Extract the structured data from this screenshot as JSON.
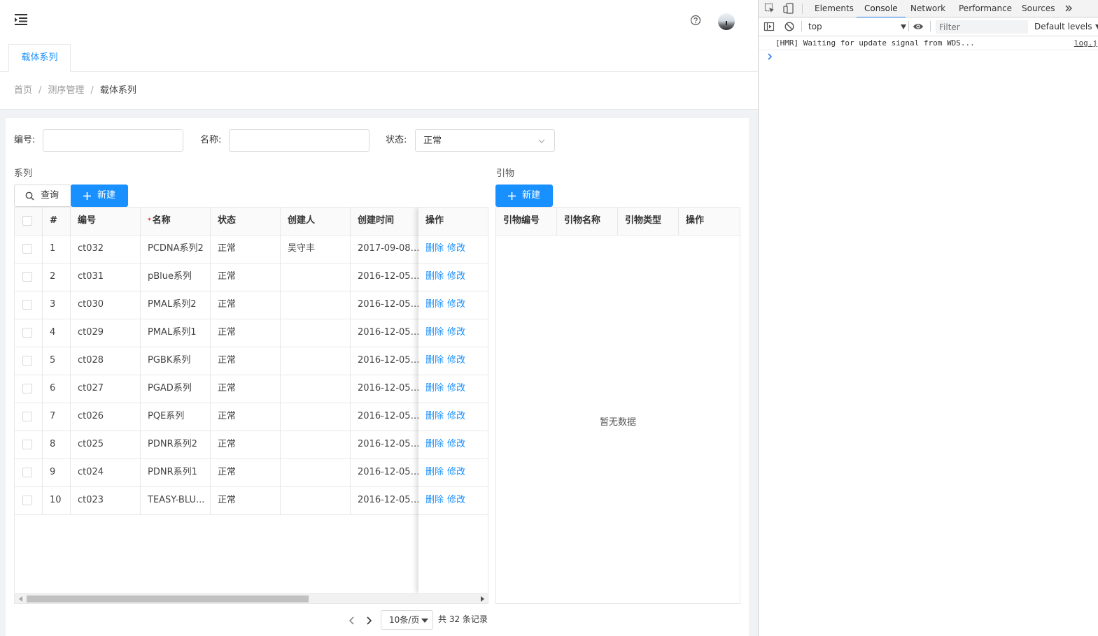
{
  "header": {
    "menu_icon": "menu-fold-icon",
    "help_icon": "question-circle-icon",
    "avatar_icon": "user-avatar"
  },
  "tabs": [
    {
      "label": "载体系列"
    }
  ],
  "breadcrumb": {
    "home": "首页",
    "parent": "测序管理",
    "current": "载体系列",
    "separator": "/"
  },
  "filters": {
    "code_label": "编号:",
    "code_value": "",
    "name_label": "名称:",
    "name_value": "",
    "status_label": "状态:",
    "status_value": "正常"
  },
  "series": {
    "title": "系列",
    "query_button": "查询",
    "new_button": "新建",
    "columns": [
      "#",
      "编号",
      "名称",
      "状态",
      "创建人",
      "创建时间",
      "操作"
    ],
    "rows": [
      {
        "no": "1",
        "code": "ct032",
        "name": "PCDNA系列2",
        "status": "正常",
        "creator": "吴守丰",
        "created": "2017-09-08 ..."
      },
      {
        "no": "2",
        "code": "ct031",
        "name": "pBlue系列",
        "status": "正常",
        "creator": "",
        "created": "2016-12-05 ..."
      },
      {
        "no": "3",
        "code": "ct030",
        "name": "PMAL系列2",
        "status": "正常",
        "creator": "",
        "created": "2016-12-05 ..."
      },
      {
        "no": "4",
        "code": "ct029",
        "name": "PMAL系列1",
        "status": "正常",
        "creator": "",
        "created": "2016-12-05 ..."
      },
      {
        "no": "5",
        "code": "ct028",
        "name": "PGBK系列",
        "status": "正常",
        "creator": "",
        "created": "2016-12-05 ..."
      },
      {
        "no": "6",
        "code": "ct027",
        "name": "PGAD系列",
        "status": "正常",
        "creator": "",
        "created": "2016-12-05 ..."
      },
      {
        "no": "7",
        "code": "ct026",
        "name": "PQE系列",
        "status": "正常",
        "creator": "",
        "created": "2016-12-05 ..."
      },
      {
        "no": "8",
        "code": "ct025",
        "name": "PDNR系列2",
        "status": "正常",
        "creator": "",
        "created": "2016-12-05 ..."
      },
      {
        "no": "9",
        "code": "ct024",
        "name": "PDNR系列1",
        "status": "正常",
        "creator": "",
        "created": "2016-12-05 ..."
      },
      {
        "no": "10",
        "code": "ct023",
        "name": "TEASY-BLU...",
        "status": "正常",
        "creator": "",
        "created": "2016-12-05 ..."
      }
    ],
    "actions": {
      "delete": "删除",
      "edit": "修改"
    }
  },
  "primers": {
    "title": "引物",
    "new_button": "新建",
    "columns": [
      "引物编号",
      "引物名称",
      "引物类型",
      "操作"
    ],
    "empty_text": "暂无数据"
  },
  "pagination": {
    "page_size": "10条/页",
    "total": "共 32 条记录"
  },
  "devtools": {
    "tabs": [
      "Elements",
      "Console",
      "Network",
      "Performance",
      "Sources"
    ],
    "active_tab": "Console",
    "more_icon": "chevron-double-right-icon",
    "context": "top",
    "filter_placeholder": "Filter",
    "levels": "Default levels",
    "messages": [
      {
        "text": "[HMR] Waiting for update signal from WDS...",
        "source": "log.j"
      }
    ]
  },
  "colors": {
    "primary": "#1890ff",
    "danger": "#f5222d",
    "devtools_accent": "#1a73e8"
  }
}
